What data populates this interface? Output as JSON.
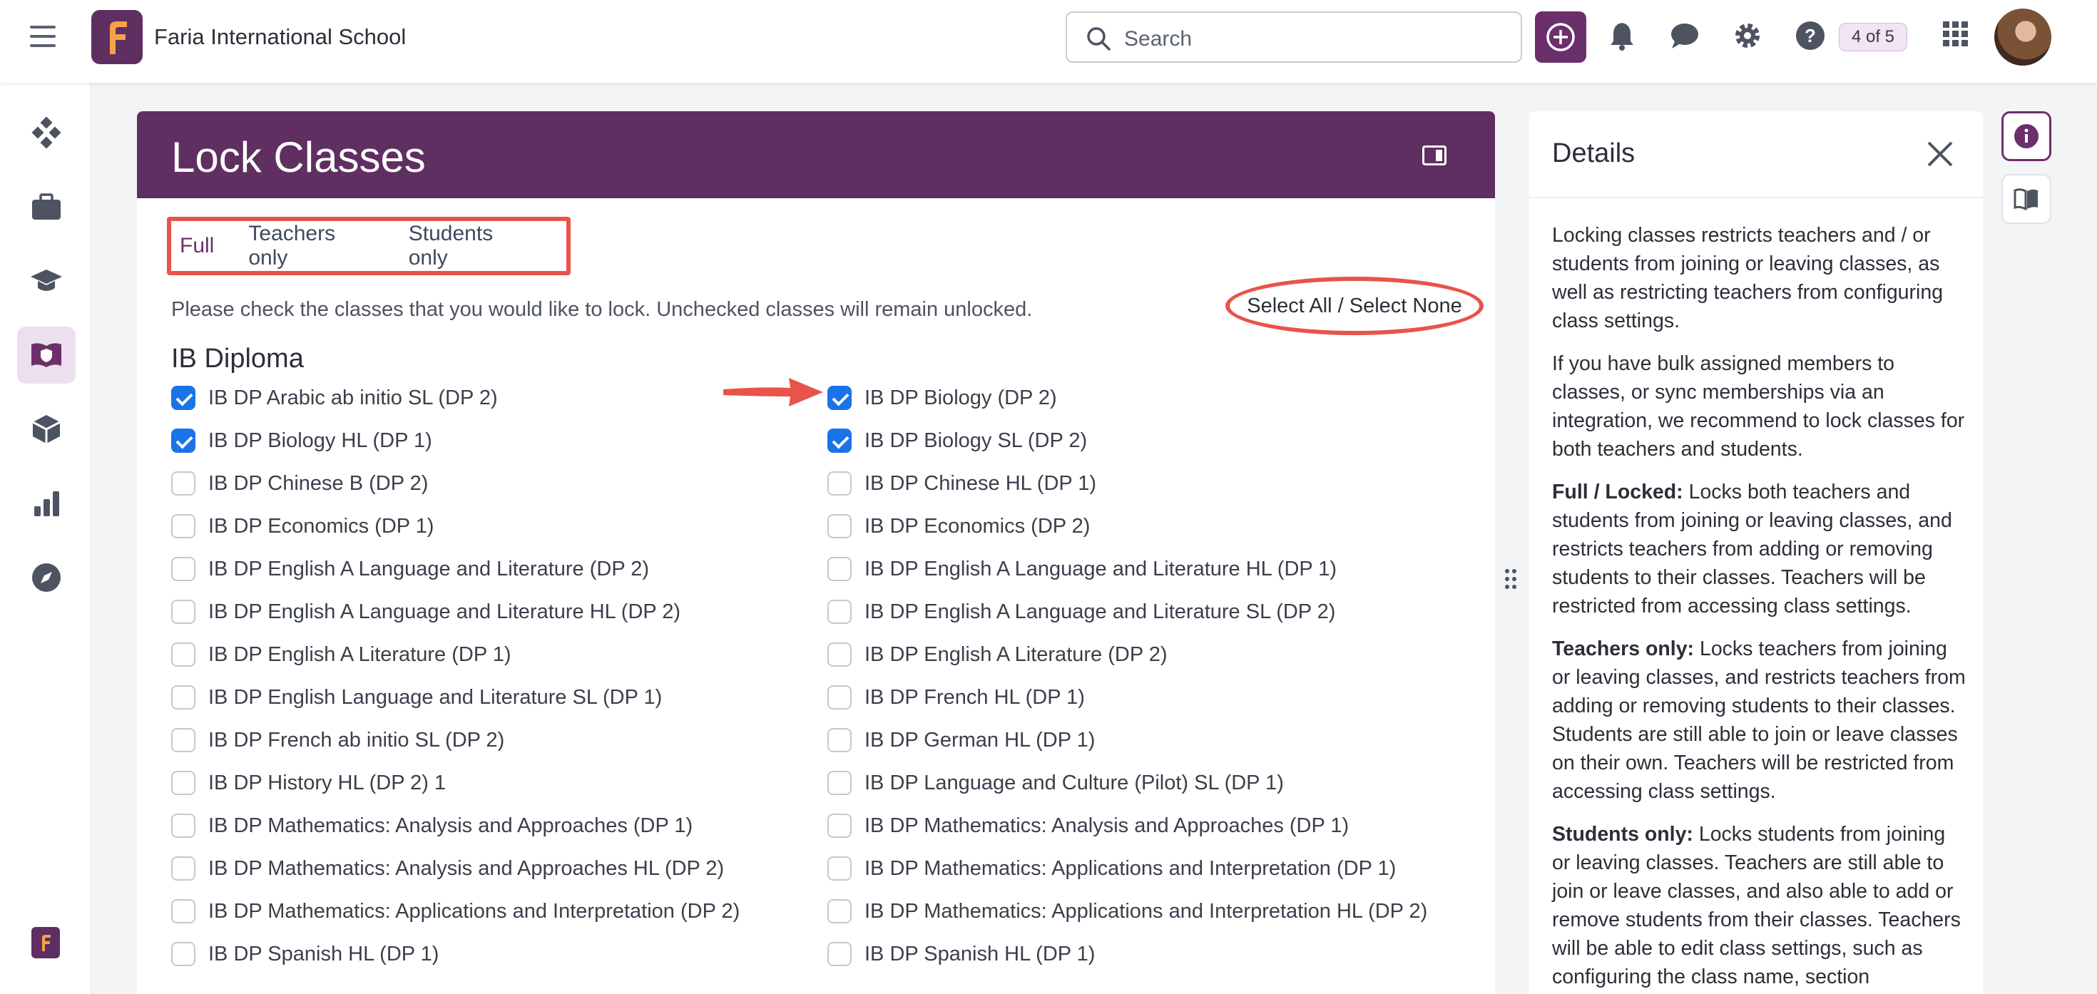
{
  "app": {
    "school_name": "Faria International School",
    "logo_letter": "F",
    "search_placeholder": "Search",
    "profile_badge": "4 of 5"
  },
  "page": {
    "title": "Lock Classes",
    "tabs": [
      "Full",
      "Teachers only",
      "Students only"
    ],
    "instruction": "Please check the classes that you would like to lock. Unchecked classes will remain unlocked.",
    "select_all_label": "Select All / Select None",
    "group_title": "IB Diploma"
  },
  "classes_left": [
    {
      "label": "IB DP Arabic ab initio SL (DP 2)",
      "checked": true
    },
    {
      "label": "IB DP Biology HL (DP 1)",
      "checked": true
    },
    {
      "label": "IB DP Chinese B (DP 2)",
      "checked": false
    },
    {
      "label": "IB DP Economics (DP 1)",
      "checked": false
    },
    {
      "label": "IB DP English A Language and Literature (DP 2)",
      "checked": false
    },
    {
      "label": "IB DP English A Language and Literature HL (DP 2)",
      "checked": false
    },
    {
      "label": "IB DP English A Literature (DP 1)",
      "checked": false
    },
    {
      "label": "IB DP English Language and Literature SL (DP 1)",
      "checked": false
    },
    {
      "label": "IB DP French ab initio SL (DP 2)",
      "checked": false
    },
    {
      "label": "IB DP History HL (DP 2) 1",
      "checked": false
    },
    {
      "label": "IB DP Mathematics: Analysis and Approaches (DP 1)",
      "checked": false
    },
    {
      "label": "IB DP Mathematics: Analysis and Approaches HL (DP 2)",
      "checked": false
    },
    {
      "label": "IB DP Mathematics: Applications and Interpretation (DP 2)",
      "checked": false
    },
    {
      "label": "IB DP Spanish HL (DP 1)",
      "checked": false
    }
  ],
  "classes_right": [
    {
      "label": "IB DP Biology (DP 2)",
      "checked": true
    },
    {
      "label": "IB DP Biology SL (DP 2)",
      "checked": true
    },
    {
      "label": "IB DP Chinese HL (DP 1)",
      "checked": false
    },
    {
      "label": "IB DP Economics (DP 2)",
      "checked": false
    },
    {
      "label": "IB DP English A Language and Literature HL (DP 1)",
      "checked": false
    },
    {
      "label": "IB DP English A Language and Literature SL (DP 2)",
      "checked": false
    },
    {
      "label": "IB DP English A Literature (DP 2)",
      "checked": false
    },
    {
      "label": "IB DP French HL (DP 1)",
      "checked": false
    },
    {
      "label": "IB DP German HL (DP 1)",
      "checked": false
    },
    {
      "label": "IB DP Language and Culture (Pilot) SL (DP 1)",
      "checked": false
    },
    {
      "label": "IB DP Mathematics: Analysis and Approaches (DP 1)",
      "checked": false
    },
    {
      "label": "IB DP Mathematics: Applications and Interpretation (DP 1)",
      "checked": false
    },
    {
      "label": "IB DP Mathematics: Applications and Interpretation HL (DP 2)",
      "checked": false
    },
    {
      "label": "IB DP Spanish HL (DP 1)",
      "checked": false
    }
  ],
  "details": {
    "title": "Details",
    "p1": "Locking classes restricts teachers and / or students from joining or leaving classes, as well as restricting teachers from configuring class settings.",
    "p2": "If you have bulk assigned members to classes, or sync memberships via an integration, we recommend to lock classes for both teachers and students.",
    "full_head": "Full / Locked:",
    "full_text": "Locks both teachers and students from joining or leaving classes, and restricts teachers from adding or removing students to their classes. Teachers will be restricted from accessing class settings.",
    "teachers_head": "Teachers only:",
    "teachers_text": "Locks teachers from joining or leaving classes, and restricts teachers from adding or removing students to their classes. Students are still able to join or leave classes on their own. Teachers will be restricted from accessing class settings.",
    "students_head": "Students only:",
    "students_text": "Locks students from joining or leaving classes. Teachers are still able to join or leave classes, and also able to add or remove students from their classes. Teachers will be able to edit class settings, such as configuring the class name, section"
  },
  "colors": {
    "brand": "#5e2f60",
    "checkbox": "#1a73e8",
    "annotation": "#e8544a"
  }
}
